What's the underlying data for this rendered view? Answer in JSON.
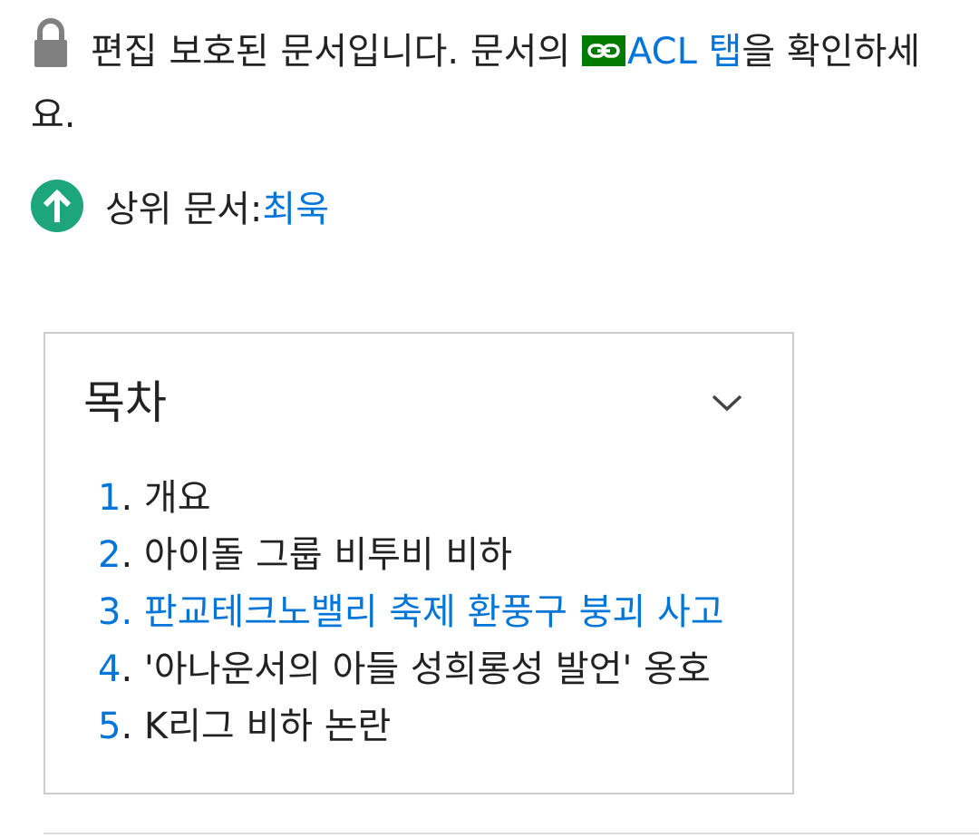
{
  "protection": {
    "text_before": "편집 보호된 문서입니다. 문서의 ",
    "link_label": "ACL 탭",
    "text_after": "을 확인하세요.",
    "icon": "lock-icon",
    "link_icon": "link-icon",
    "link_badge_color": "#007a00"
  },
  "parent": {
    "label": "상위 문서: ",
    "link": "최욱",
    "icon": "arrow-up-circle-icon",
    "icon_color": "#1da67a"
  },
  "toc": {
    "title": "목차",
    "toggle_icon": "chevron-down-icon",
    "items": [
      {
        "num": "1",
        "label": "개요"
      },
      {
        "num": "2",
        "label": "아이돌 그룹 비투비 비하"
      },
      {
        "num": "3",
        "label": "판교테크노밸리 축제 환풍구 붕괴 사고"
      },
      {
        "num": "4",
        "label": "'아나운서의 아들 성희롱성 발언' 옹호"
      },
      {
        "num": "5",
        "label": "K리그 비하 논란"
      }
    ]
  },
  "colors": {
    "link": "#0275d8",
    "text": "#222222",
    "border": "#cccccc"
  }
}
